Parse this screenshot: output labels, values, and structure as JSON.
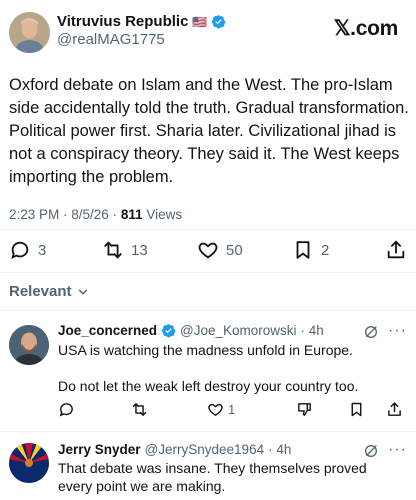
{
  "colors": {
    "text": "#0f1419",
    "muted": "#536471",
    "verified": "#1d9bf0",
    "separator": "#eff3f4"
  },
  "tweet": {
    "display_name": "Vitruvius Republic",
    "flag": "🇺🇸",
    "verified_icon": "verified-badge-icon",
    "handle": "@realMAG1775",
    "site_logo": "𝕏.com",
    "text": "Oxford debate on Islam and the West. The pro-Islam side accidentally told the truth. Gradual transformation. Political power first. Sharia later. Civilizational jihad is not a conspiracy theory. They said it. The West keeps importing the problem.",
    "timestamp": "2:23 PM · 8/5/26 · ",
    "views_count": "811",
    "views_label": " Views",
    "actions": {
      "replies": "3",
      "retweets": "13",
      "likes": "50",
      "bookmarks": "2"
    }
  },
  "relevant_label": "Relevant",
  "replies": [
    {
      "name": "Joe_concerned",
      "handle": "@Joe_Komorowski",
      "time": "· 4h",
      "text_line1": "USA is watching the madness unfold in Europe.",
      "text_line2": "Do not let the weak left destroy your country too.",
      "likes": "1"
    },
    {
      "name": "Jerry Snyder",
      "handle": "@JerrySnydee1964",
      "time": "· 4h",
      "text": "That debate was insane. They themselves proved every point we are making."
    }
  ]
}
